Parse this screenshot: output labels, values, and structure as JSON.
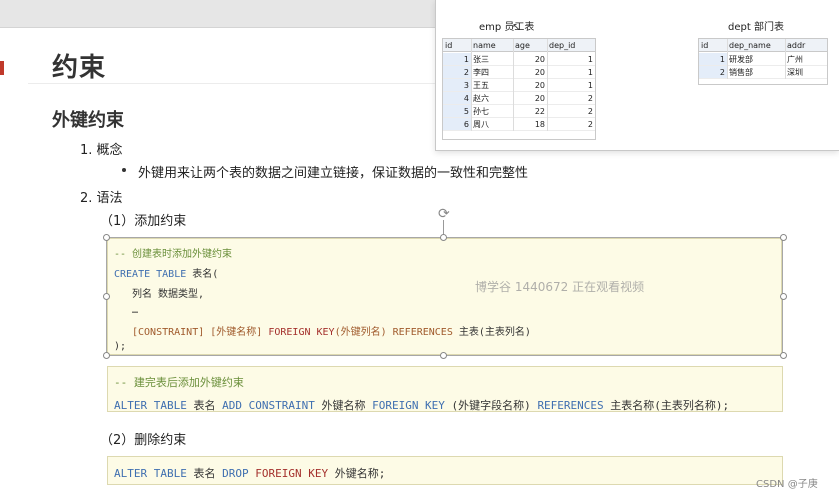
{
  "heading_main": "约束",
  "heading_fk": "外键约束",
  "list": {
    "item1": "1. 概念",
    "bullet1": "外键用来让两个表的数据之间建立链接，保证数据的一致性和完整性",
    "item2": "2. 语法",
    "sub1": "（1）添加约束",
    "sub2": "（2）删除约束"
  },
  "code_create": {
    "comment": "-- 创建表时添加外键约束",
    "l1_kw": "CREATE TABLE",
    "l1_rest": " 表名(",
    "l2": "列名 数据类型,",
    "l3": "…",
    "l4_kw1": "[CONSTRAINT]",
    "l4_b1": " [外键名称] ",
    "l4_kw2": "FOREIGN KEY",
    "l4_b2": "(外键列名) ",
    "l4_kw3": "REFERENCES",
    "l4_b3": " 主表(主表列名)",
    "l5": ");"
  },
  "code_alter": {
    "comment": "-- 建完表后添加外键约束",
    "kw1": "ALTER TABLE",
    "t1": " 表名 ",
    "kw2": "ADD CONSTRAINT",
    "t2": " 外键名称 ",
    "kw3": "FOREIGN KEY",
    "t3": " (外键字段名称) ",
    "kw4": "REFERENCES",
    "t4": " 主表名称(主表列名称);"
  },
  "code_drop": {
    "kw1": "ALTER TABLE",
    "t1": " 表名 ",
    "kw2": "DROP",
    "t2": " ",
    "kw3": "FOREIGN KEY",
    "t3": " 外键名称;"
  },
  "watermark": "博学谷 1440672 正在观看视频",
  "emp_table": {
    "label": "emp 员工表",
    "columns": [
      "id",
      "name",
      "age",
      "dep_id"
    ],
    "rows": [
      [
        "1",
        "张三",
        "20",
        "1"
      ],
      [
        "2",
        "李四",
        "20",
        "1"
      ],
      [
        "3",
        "王五",
        "20",
        "1"
      ],
      [
        "4",
        "赵六",
        "20",
        "2"
      ],
      [
        "5",
        "孙七",
        "22",
        "2"
      ],
      [
        "6",
        "周八",
        "18",
        "2"
      ]
    ]
  },
  "dept_table": {
    "label": "dept 部门表",
    "columns": [
      "id",
      "dep_name",
      "addr"
    ],
    "rows": [
      [
        "1",
        "研发部",
        "广州"
      ],
      [
        "2",
        "销售部",
        "深圳"
      ]
    ]
  },
  "footer": "CSDN @子庚",
  "colors": {
    "accent": "#c0392b",
    "keyword": "#3f6fb0",
    "comment": "#6a8f3a",
    "code_bg": "#fdfbe6"
  }
}
